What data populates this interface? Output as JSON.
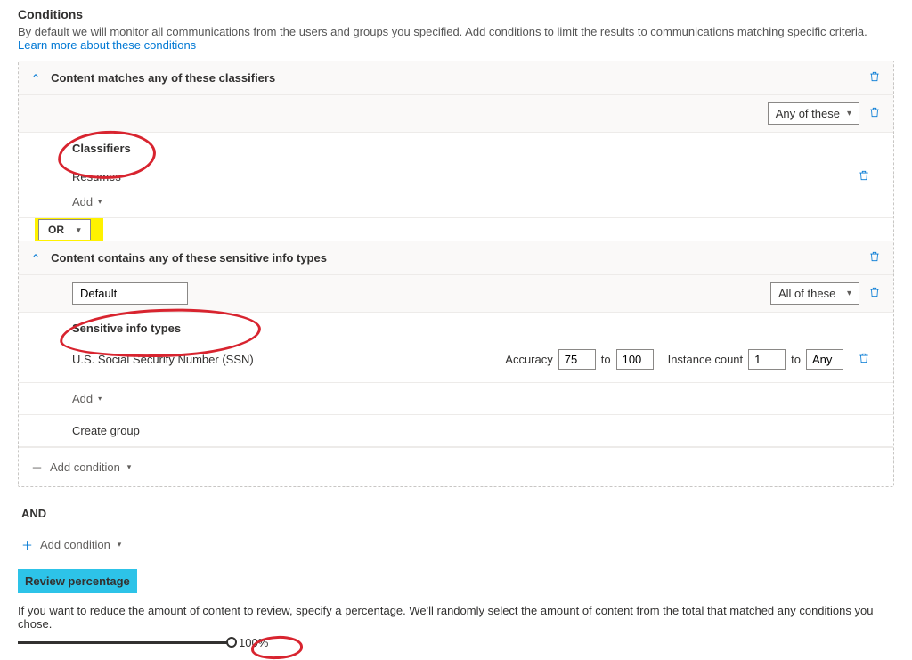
{
  "header": {
    "title": "Conditions",
    "desc": "By default we will monitor all communications from the users and groups you specified. Add conditions to limit the results to communications matching specific criteria.",
    "learn_link": "Learn more about these conditions"
  },
  "cond1": {
    "title": "Content matches any of these classifiers",
    "match_mode": "Any of these",
    "section_label": "Classifiers",
    "item": "Resumes",
    "add": "Add"
  },
  "operator": "OR",
  "cond2": {
    "title": "Content contains any of these sensitive info types",
    "group_name": "Default",
    "match_mode": "All of these",
    "section_label": "Sensitive info types",
    "item": "U.S. Social Security Number (SSN)",
    "accuracy_label": "Accuracy",
    "accuracy_from": "75",
    "accuracy_to_label": "to",
    "accuracy_to": "100",
    "instance_label": "Instance count",
    "instance_from": "1",
    "instance_to_label": "to",
    "instance_to": "Any",
    "add": "Add",
    "create_group": "Create group"
  },
  "inner_add": "Add condition",
  "and_label": "AND",
  "outer_add": "Add condition",
  "review": {
    "title": "Review percentage",
    "desc": "If you want to reduce the amount of content to review, specify a percentage. We'll randomly select the amount of content from the total that matched any conditions you chose.",
    "value": "100%"
  }
}
